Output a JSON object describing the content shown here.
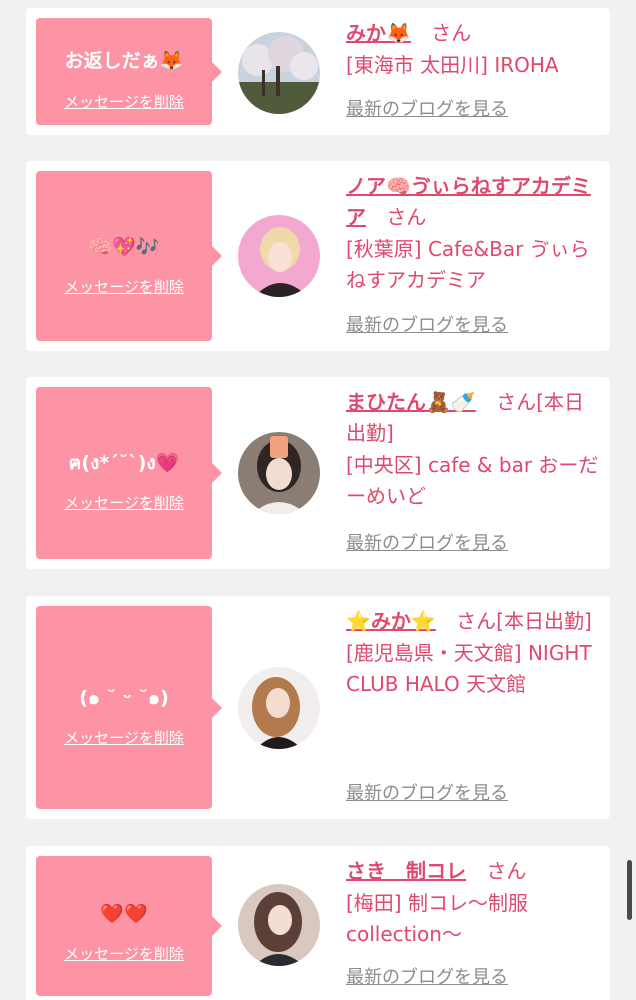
{
  "items": [
    {
      "bubble_message": "お返しだぁ🦊",
      "delete_label": "メッセージを削除",
      "name": "みか🦊",
      "suffix": "さん",
      "shop": "[東海市 太田川] IROHA",
      "blog_label": "最新のブログを見る"
    },
    {
      "bubble_message": "🧠💖🎶",
      "delete_label": "メッセージを削除",
      "name": "ノア🧠ゔぃらねすアカデミア",
      "suffix": "さん",
      "shop": "[秋葉原] Cafe&Bar ゔぃらねすアカデミア",
      "blog_label": "最新のブログを見る"
    },
    {
      "bubble_message": "ฅ(ง*´˘`)ง💗",
      "delete_label": "メッセージを削除",
      "name": "まひたん🧸🍼",
      "suffix": "さん[本日出勤]",
      "shop": "[中央区] cafe & bar おーだーめいど",
      "blog_label": "最新のブログを見る"
    },
    {
      "bubble_message": "(๑ ˘ ᵕ ˘๑)",
      "delete_label": "メッセージを削除",
      "name": "⭐️みか⭐️",
      "suffix": "さん[本日出勤]",
      "shop": "[鹿児島県・天文館] NIGHT CLUB HALO 天文館",
      "blog_label": "最新のブログを見る"
    },
    {
      "bubble_message": "❤️❤️",
      "delete_label": "メッセージを削除",
      "name": "さき　制コレ",
      "suffix": "さん",
      "shop": "[梅田] 制コレ〜制服collection〜",
      "blog_label": "最新のブログを見る"
    }
  ],
  "colors": {
    "accent_pink": "#fc94a5",
    "name_pink": "#e0486d",
    "link_gray": "#8c8c8c"
  }
}
